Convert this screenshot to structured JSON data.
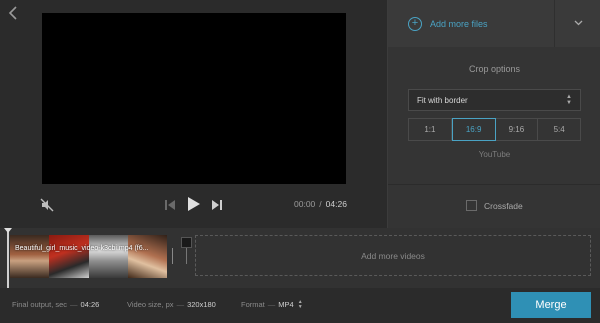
{
  "preview": {
    "back_icon": "chevron-left-icon",
    "current_time": "00:00",
    "separator": "/",
    "total_time": "04:26"
  },
  "panel": {
    "add_files_label": "Add more files",
    "crop_title": "Crop options",
    "crop_mode": "Fit with border",
    "ratios": [
      "1:1",
      "16:9",
      "9:16",
      "5:4"
    ],
    "active_ratio": "16:9",
    "ratio_note": "YouTube",
    "crossfade_label": "Crossfade"
  },
  "timeline": {
    "clip_name": "Beautiful_girl_music_video-k3cbi.mp4 (f6...",
    "add_videos_label": "Add more videos"
  },
  "bottom": {
    "final_output_label": "Final output, sec",
    "final_output_value": "04:26",
    "video_size_label": "Video size, px",
    "video_size_value": "320x180",
    "format_label": "Format",
    "format_value": "MP4",
    "merge_label": "Merge"
  },
  "colors": {
    "accent": "#4aa3c4",
    "merge_button": "#2f90b5",
    "background": "#2b2b2b",
    "panel": "#343434"
  }
}
